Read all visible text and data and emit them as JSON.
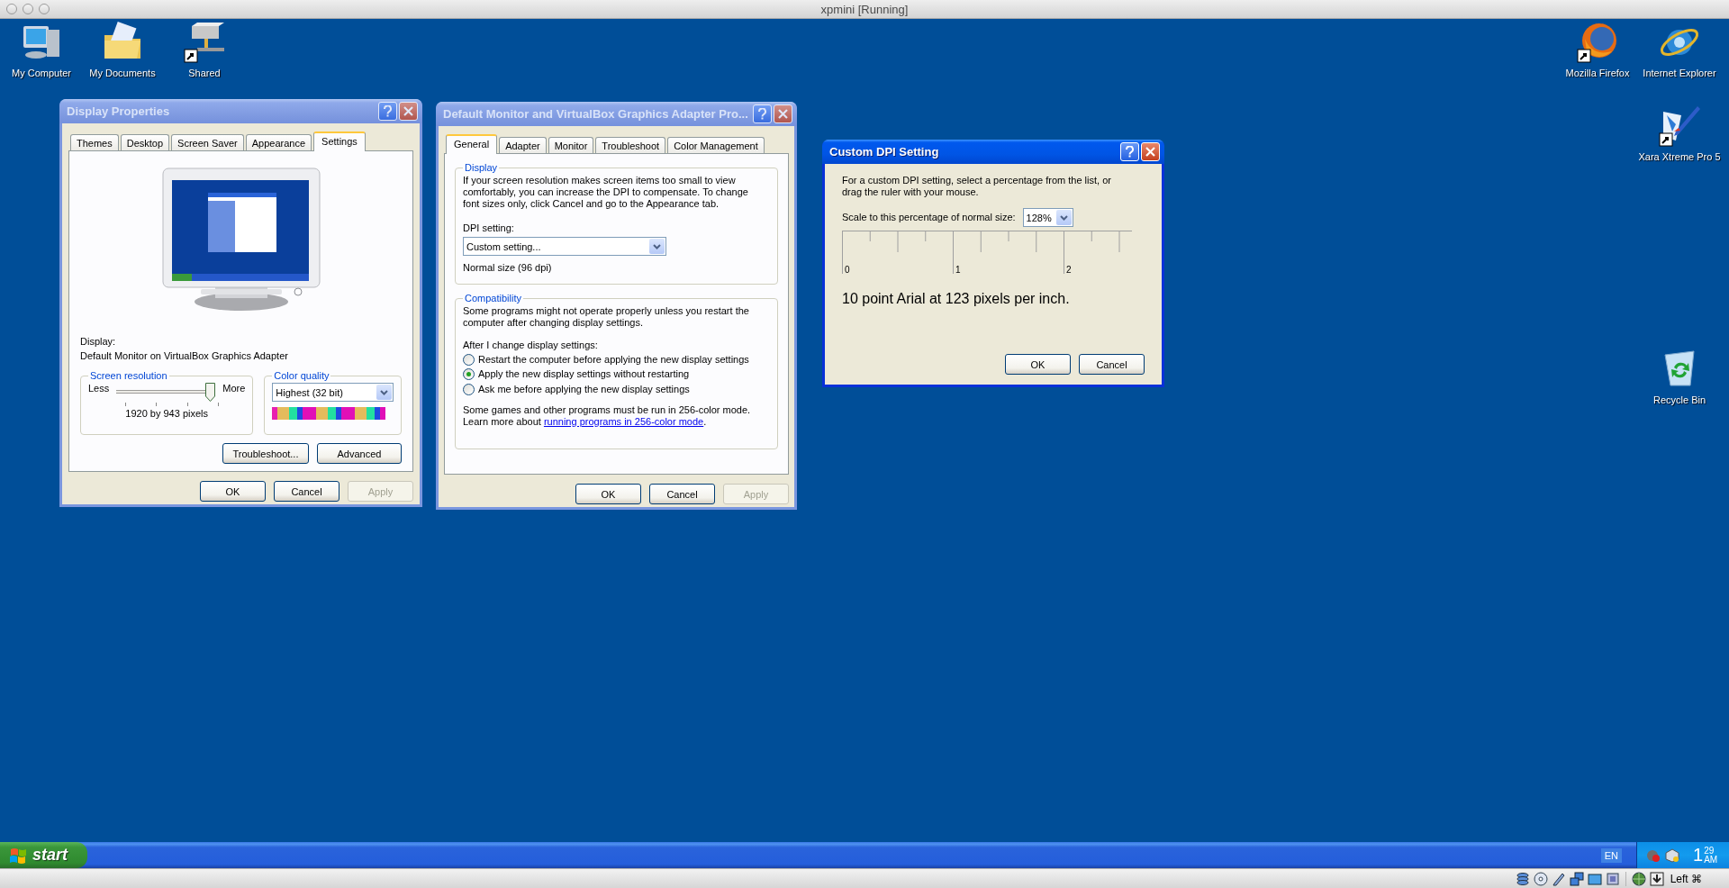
{
  "host_window": {
    "title": "xpmini [Running]"
  },
  "desktop_icons": [
    {
      "kind": "computer",
      "label": "My Computer",
      "shortcut": false
    },
    {
      "kind": "documents",
      "label": "My Documents",
      "shortcut": false
    },
    {
      "kind": "network_drive",
      "label": "Shared",
      "shortcut": true
    },
    {
      "kind": "firefox",
      "label": "Mozilla Firefox",
      "shortcut": true
    },
    {
      "kind": "internet_explorer",
      "label": "Internet Explorer",
      "shortcut": false
    },
    {
      "kind": "xara",
      "label": "Xara Xtreme Pro 5",
      "shortcut": true
    },
    {
      "kind": "recycle_bin",
      "label": "Recycle Bin",
      "shortcut": false
    }
  ],
  "display_properties": {
    "title": "Display Properties",
    "active": false,
    "tabs": [
      {
        "label": "Themes",
        "selected": false
      },
      {
        "label": "Desktop",
        "selected": false
      },
      {
        "label": "Screen Saver",
        "selected": false
      },
      {
        "label": "Appearance",
        "selected": false
      },
      {
        "label": "Settings",
        "selected": true
      }
    ],
    "display_label": "Display:",
    "display_name": "Default Monitor on VirtualBox Graphics Adapter",
    "screen_resolution": {
      "title": "Screen resolution",
      "less": "Less",
      "more": "More",
      "level": 1,
      "reading": "1920 by 943 pixels"
    },
    "color_quality": {
      "title": "Color quality",
      "value": "Highest (32 bit)"
    },
    "buttons": [
      "Troubleshoot...",
      "Advanced"
    ],
    "footer_buttons": [
      {
        "label": "OK",
        "disabled": false
      },
      {
        "label": "Cancel",
        "disabled": false
      },
      {
        "label": "Apply",
        "disabled": true
      }
    ]
  },
  "adapter_properties": {
    "title": "Default Monitor and VirtualBox Graphics Adapter Pro...",
    "active": false,
    "tabs": [
      {
        "label": "General",
        "selected": true
      },
      {
        "label": "Adapter",
        "selected": false
      },
      {
        "label": "Monitor",
        "selected": false
      },
      {
        "label": "Troubleshoot",
        "selected": false
      },
      {
        "label": "Color Management",
        "selected": false
      }
    ],
    "display_group": {
      "title": "Display",
      "text": "If your screen resolution makes screen items too small to view comfortably, you can increase the DPI to compensate.  To change font sizes only, click Cancel and go to the Appearance tab.",
      "dpi_label": "DPI setting:",
      "dpi_value": "Custom setting...",
      "note": "Normal size (96 dpi)"
    },
    "compatibility_group": {
      "title": "Compatibility",
      "text": "Some programs might not operate properly unless you restart the computer after changing display settings.",
      "prompt": "After I change display settings:",
      "options": [
        {
          "label": "Restart the computer before applying the new display settings",
          "selected": false
        },
        {
          "label": "Apply the new display settings without restarting",
          "selected": true
        },
        {
          "label": "Ask me before applying the new display settings",
          "selected": false
        }
      ],
      "note_before": "Some games and other programs must be run in 256-color mode. Learn more about",
      "link": "running programs in 256-color mode",
      "note_after": "."
    },
    "footer_buttons": [
      {
        "label": "OK",
        "disabled": false
      },
      {
        "label": "Cancel",
        "disabled": false
      },
      {
        "label": "Apply",
        "disabled": true
      }
    ]
  },
  "custom_dpi": {
    "title": "Custom DPI Setting",
    "active": true,
    "instructions": "For a custom DPI setting, select a percentage from the list, or drag the ruler with your mouse.",
    "scale_label": "Scale to this percentage of normal size:",
    "scale_value": "128%",
    "ruler_labels": [
      "0",
      "1",
      "2"
    ],
    "sample": "10 point Arial at 123 pixels per inch.",
    "footer_buttons": [
      {
        "label": "OK",
        "disabled": false
      },
      {
        "label": "Cancel",
        "disabled": false
      }
    ]
  },
  "taskbar": {
    "start": "start",
    "language": "EN",
    "clock": {
      "hour": "1",
      "minutes": "29",
      "meridiem": "AM"
    }
  },
  "host_status_bar": {
    "keyboard_label": "Left ⌘"
  }
}
